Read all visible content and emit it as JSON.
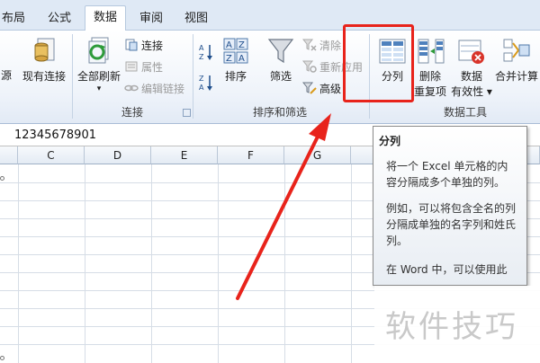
{
  "tabs": [
    {
      "label": "布局"
    },
    {
      "label": "公式"
    },
    {
      "label": "数据"
    },
    {
      "label": "审阅"
    },
    {
      "label": "视图"
    }
  ],
  "active_tab": "数据",
  "ribbon": {
    "partial_left_label": "源",
    "existing_connections": "现有连接",
    "refresh_all": "全部刷新",
    "connections": "连接",
    "properties": "属性",
    "edit_links": "编辑链接",
    "group_connections": "连接",
    "sort_az": "A↓Z",
    "sort_za": "Z↓A",
    "sort": "排序",
    "filter": "筛选",
    "clear": "清除",
    "reapply": "重新应用",
    "advanced": "高级",
    "group_sort_filter": "排序和筛选",
    "text_to_columns": "分列",
    "remove_duplicates_1": "删除",
    "remove_duplicates_2": "重复项",
    "data_validation_1": "数据",
    "data_validation_2": "有效性",
    "consolidate": "合并计算",
    "group_data_tools": "数据工具"
  },
  "formula_bar": {
    "value": "12345678901"
  },
  "columns": [
    "C",
    "D",
    "E",
    "F",
    "G"
  ],
  "tooltip": {
    "title": "分列",
    "p1_l1": "将一个 Excel 单元格的内",
    "p1_l2": "容分隔成多个单独的列。",
    "p2_l1": "例如，可以将包含全名的列",
    "p2_l2": "分隔成单独的名字列和姓氏",
    "p2_l3": "列。",
    "p3_l1": "在 Word 中，可以使用此"
  },
  "watermark": "软件技巧",
  "colors": {
    "accent_red": "#e8231b",
    "ribbon_bg": "#eef3fa",
    "tab_bg": "#dfe9f5"
  }
}
